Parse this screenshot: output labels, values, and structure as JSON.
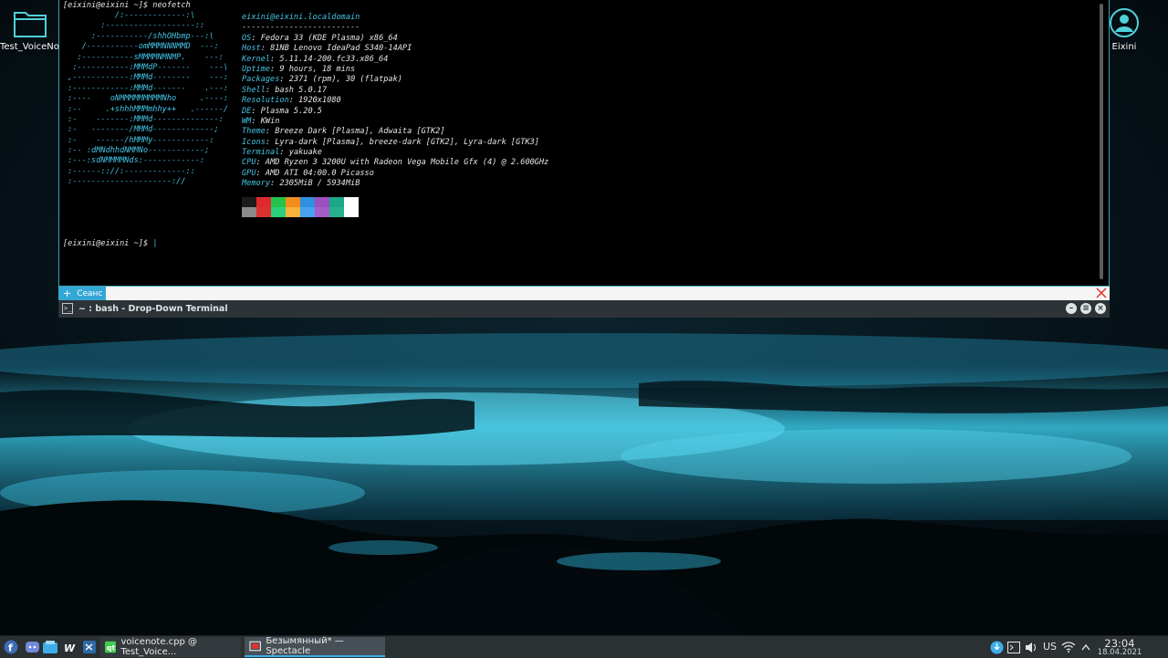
{
  "desktop": {
    "folder_label": "Test_VoiceNot",
    "home_label": "Eixini"
  },
  "terminal": {
    "command_line": "[eixini@eixini ~]$ neofetch",
    "prompt": "[eixini@eixini ~]$",
    "ascii": [
      "           /:-------------:\\",
      "        :-------------------::",
      "      :-----------/shhOHbmp---:\\",
      "    /-----------omMMMNNNMMD  ---:",
      "   :-----------sMMMMNMNMP.    ---:",
      "  :-----------:MMMdP-------    ---\\",
      " ,------------:MMMd--------    ---:",
      " :------------:MMMd-------    .---:",
      " :----    oNMMMMMMMMMNho     .----:",
      " :--     .+shhhMMMmhhy++   .------/",
      " :-    -------:MMMd--------------:",
      " :-   --------/MMMd-------------;",
      " :-    ------/hMMMy------------:",
      " :-- :dMNdhhdNMMNo------------;",
      " :---:sdNMMMMNds:------------:",
      " :------:://:-------------::",
      " :---------------------://"
    ],
    "user_host": "eixini@eixini.localdomain",
    "separator": "-------------------------",
    "info": [
      {
        "key": "OS",
        "value": "Fedora 33 (KDE Plasma) x86_64"
      },
      {
        "key": "Host",
        "value": "81NB Lenovo IdeaPad S340-14API"
      },
      {
        "key": "Kernel",
        "value": "5.11.14-200.fc33.x86_64"
      },
      {
        "key": "Uptime",
        "value": "9 hours, 18 mins"
      },
      {
        "key": "Packages",
        "value": "2371 (rpm), 30 (flatpak)"
      },
      {
        "key": "Shell",
        "value": "bash 5.0.17"
      },
      {
        "key": "Resolution",
        "value": "1920x1080"
      },
      {
        "key": "DE",
        "value": "Plasma 5.20.5"
      },
      {
        "key": "WM",
        "value": "KWin"
      },
      {
        "key": "Theme",
        "value": "Breeze Dark [Plasma], Adwaita [GTK2]"
      },
      {
        "key": "Icons",
        "value": "Lyra-dark [Plasma], breeze-dark [GTK2], Lyra-dark [GTK3]"
      },
      {
        "key": "Terminal",
        "value": "yakuake"
      },
      {
        "key": "CPU",
        "value": "AMD Ryzen 3 3200U with Radeon Vega Mobile Gfx (4) @ 2.600GHz"
      },
      {
        "key": "GPU",
        "value": "AMD ATI 04:00.0 Picasso"
      },
      {
        "key": "Memory",
        "value": "2305MiB / 5934MiB"
      }
    ],
    "colors_top": [
      "#1c1c1c",
      "#e0282e",
      "#26c24b",
      "#f28c1a",
      "#2f8fe0",
      "#9b4fc0",
      "#1aa887",
      "#ffffff"
    ],
    "colors_bottom": [
      "#8a8a8a",
      "#d9322f",
      "#2bd17a",
      "#f7b23b",
      "#45a3f0",
      "#a45dc8",
      "#27b08e",
      "#ffffff"
    ],
    "tab_label": "Сеанс",
    "window_title": "~ : bash - Drop-Down Terminal"
  },
  "panel": {
    "tasks": [
      {
        "label": "voicenote.cpp @ Test_Voice..."
      },
      {
        "label": "Безымянный* — Spectacle"
      }
    ],
    "keyboard_layout": "US",
    "clock_time": "23:04",
    "clock_date": "18.04.2021"
  }
}
